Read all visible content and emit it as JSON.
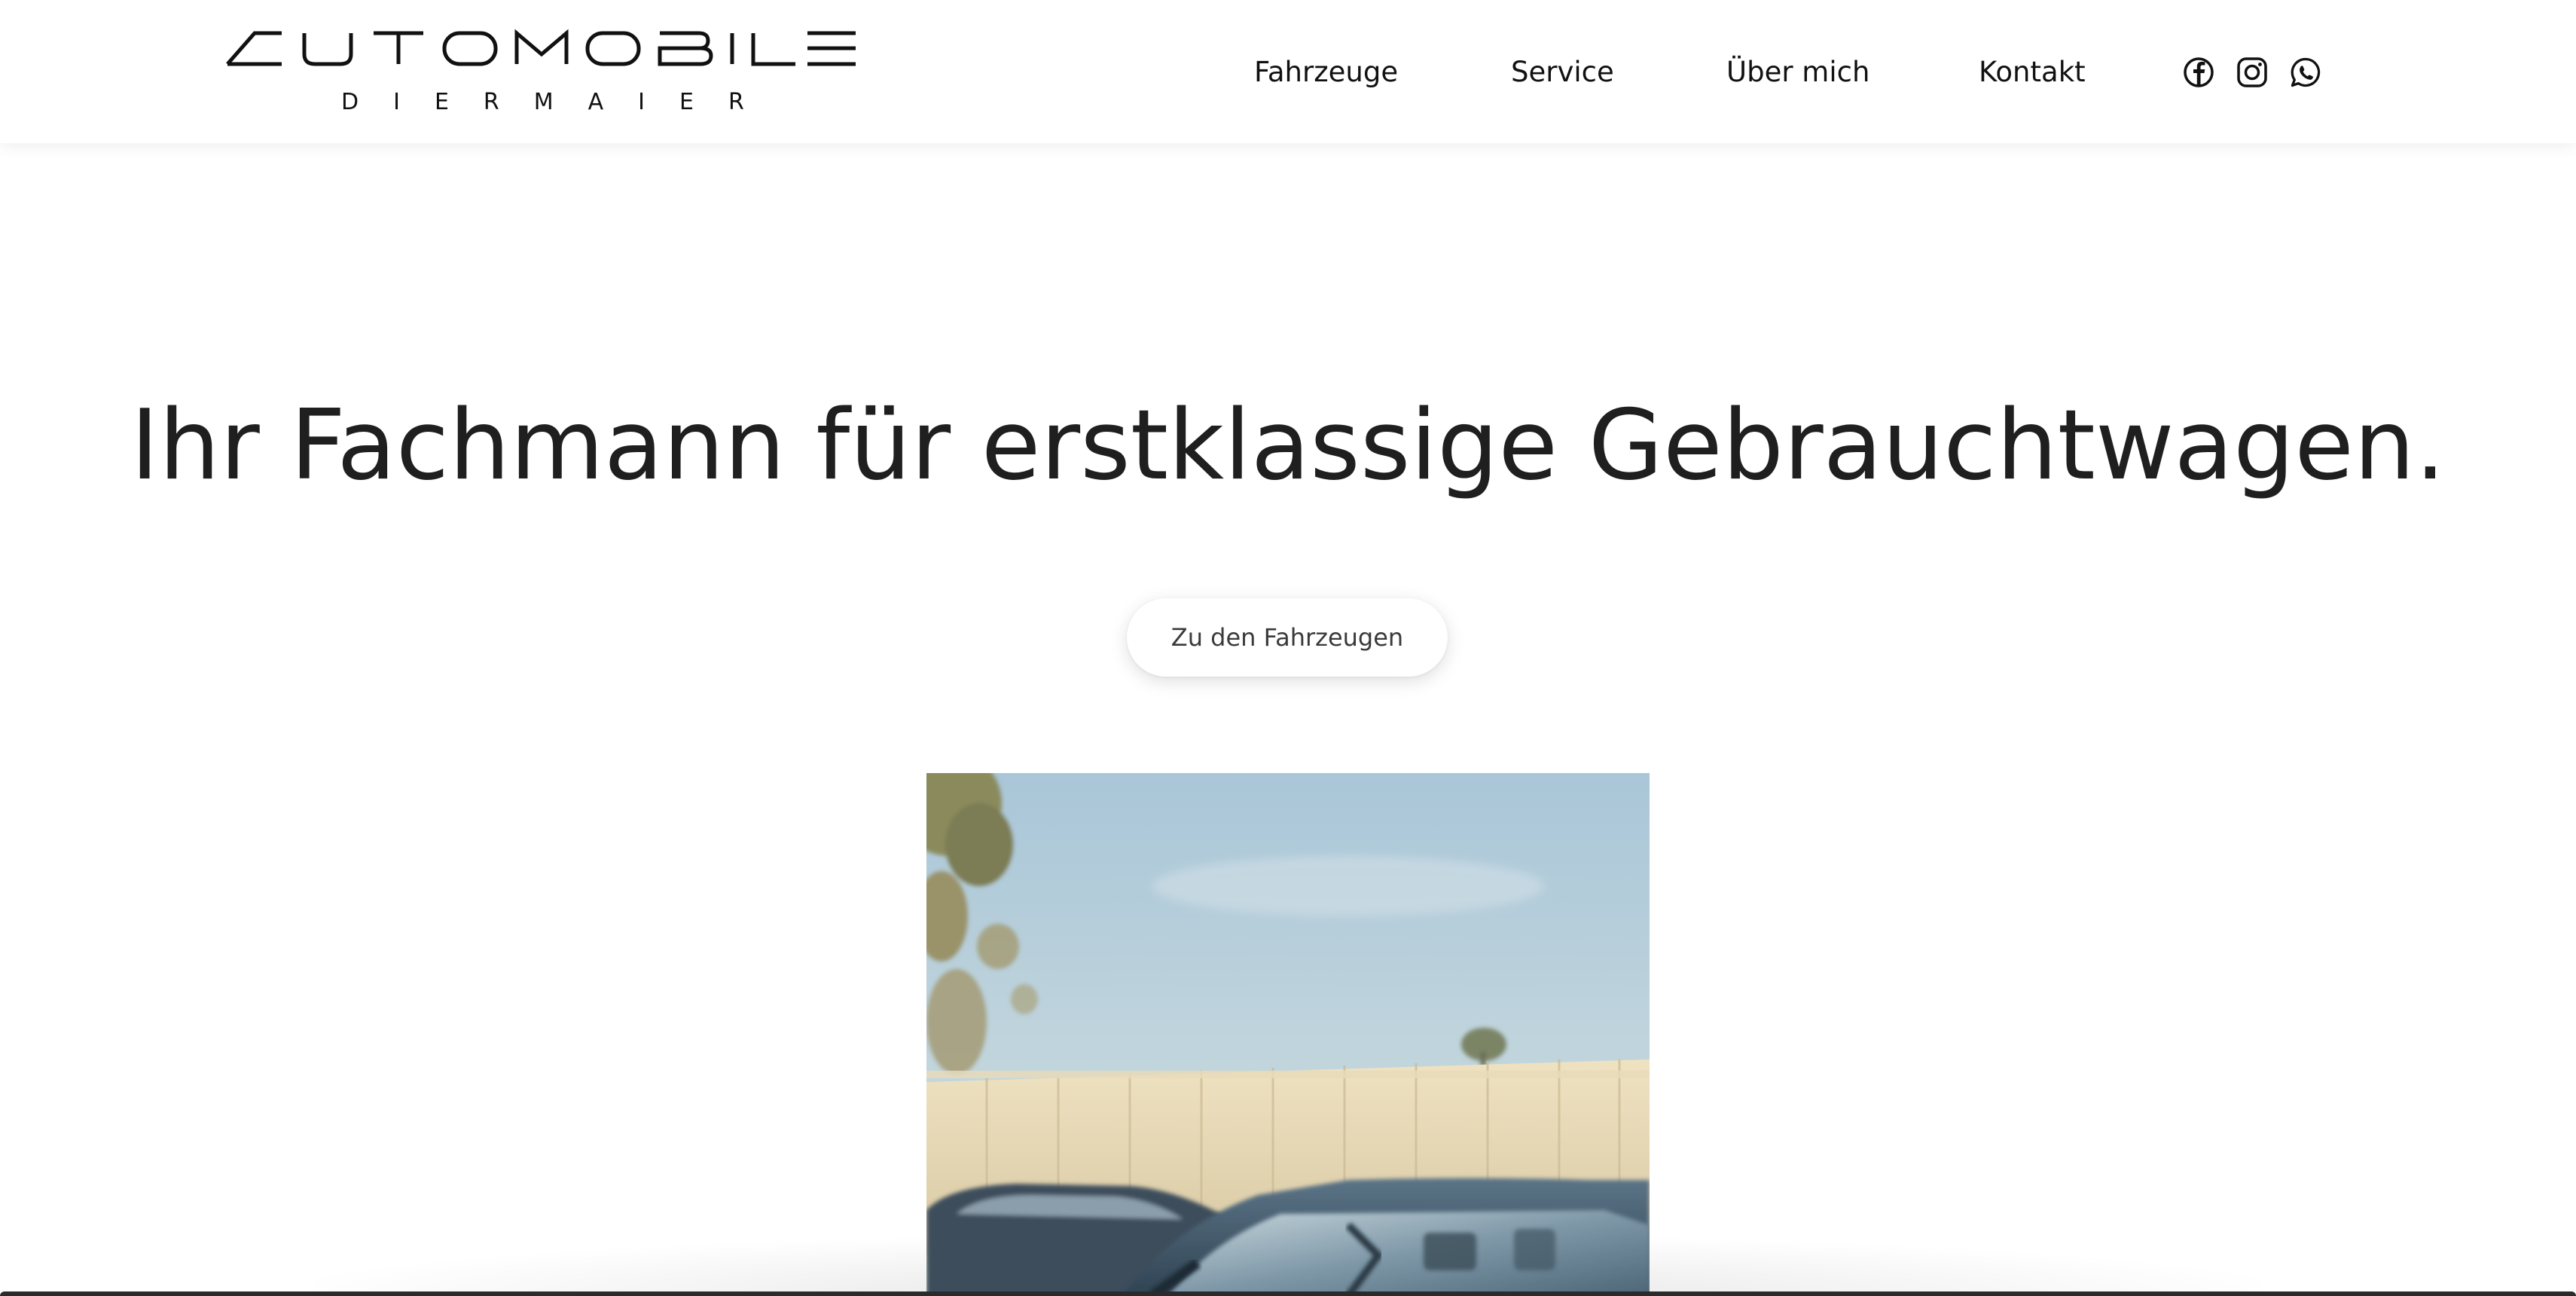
{
  "brand": {
    "logo_wordmark": "AUTOMOBILE",
    "logo_subtitle": "DIERMAIER"
  },
  "nav": {
    "items": [
      {
        "label": "Fahrzeuge"
      },
      {
        "label": "Service"
      },
      {
        "label": "Über mich"
      },
      {
        "label": "Kontakt"
      }
    ],
    "social": [
      {
        "icon": "facebook-icon"
      },
      {
        "icon": "instagram-icon"
      },
      {
        "icon": "whatsapp-icon"
      }
    ]
  },
  "hero": {
    "headline": "Ihr Fachmann für erstklassige Gebrauchtwagen.",
    "cta_label": "Zu den Fahrzeugen"
  },
  "colors": {
    "background": "#ffffff",
    "text": "#1f1f1f",
    "sky": "#b9d2df",
    "car": "#3e5566"
  }
}
